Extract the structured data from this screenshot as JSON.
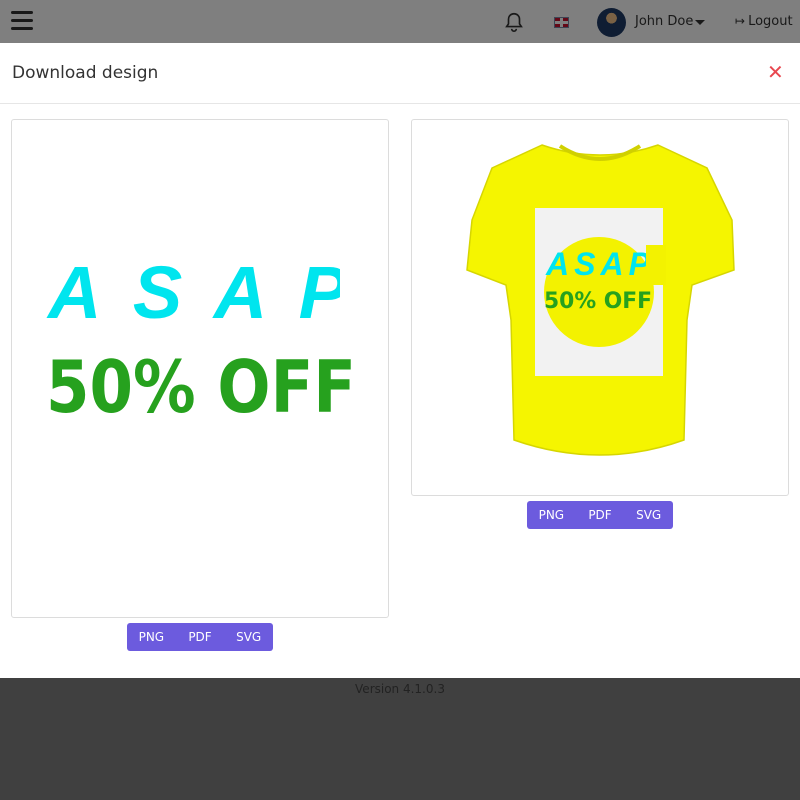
{
  "topbar": {
    "user_name": "John Doe",
    "logout_label": "Logout",
    "logout_icon": "↦"
  },
  "modal": {
    "title": "Download design",
    "close_symbol": "✕"
  },
  "design": {
    "line1": "ASAP",
    "line2": "50% OFF",
    "colors": {
      "line1": "#00e5ee",
      "line2": "#26a11e",
      "tshirt": "#f5f500",
      "circle": "#f3f200"
    }
  },
  "download_buttons": {
    "png": "PNG",
    "pdf": "PDF",
    "svg": "SVG"
  },
  "footer": {
    "version": "Version 4.1.0.3"
  }
}
